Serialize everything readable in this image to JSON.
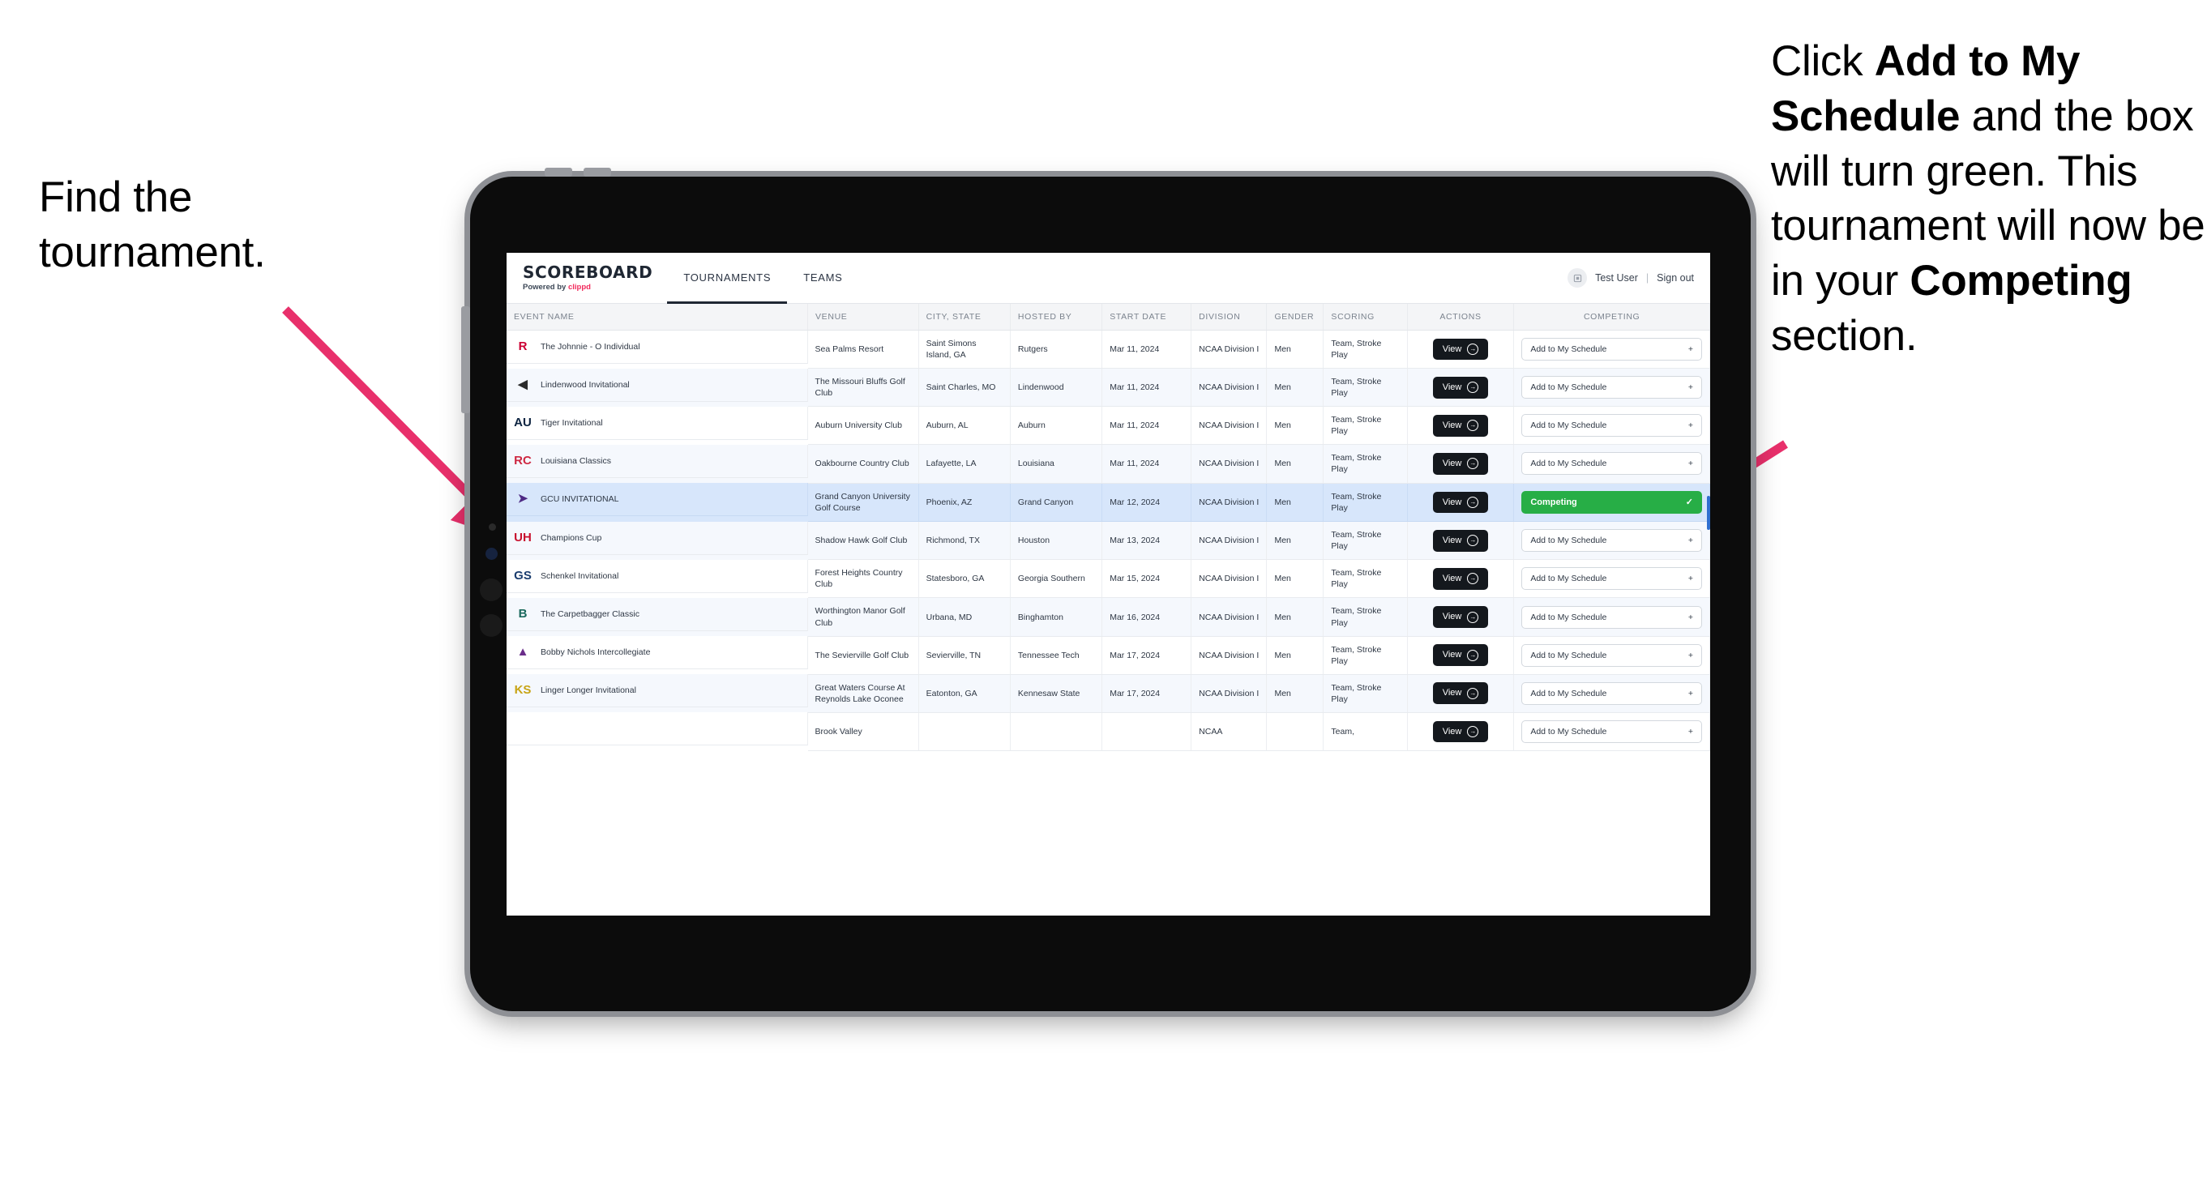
{
  "annotations": {
    "left": "Find the tournament.",
    "right_parts": [
      {
        "t": "Click ",
        "b": false
      },
      {
        "t": "Add to My Schedule",
        "b": true
      },
      {
        "t": " and the box will turn green. This tournament will now be in your ",
        "b": false
      },
      {
        "t": "Competing",
        "b": true
      },
      {
        "t": " section.",
        "b": false
      }
    ],
    "arrow_color": "#e8306b"
  },
  "app": {
    "brand_title": "SCOREBOARD",
    "brand_powered_prefix": "Powered by ",
    "brand_powered_name": "clippd",
    "tabs": [
      {
        "label": "TOURNAMENTS",
        "active": true
      },
      {
        "label": "TEAMS",
        "active": false
      }
    ],
    "user_name": "Test User",
    "separator": "|",
    "sign_out": "Sign out",
    "avatar_icon": "user-avatar-icon"
  },
  "table": {
    "columns": [
      "EVENT NAME",
      "VENUE",
      "CITY, STATE",
      "HOSTED BY",
      "START DATE",
      "DIVISION",
      "GENDER",
      "SCORING",
      "ACTIONS",
      "COMPETING"
    ],
    "view_label": "View",
    "add_label": "Add to My Schedule",
    "add_plus": "+",
    "competing_label": "Competing",
    "competing_check": "✓",
    "competing_color": "#27ae46",
    "selected_row_color": "#d7e6fb",
    "rows": [
      {
        "event": "The Johnnie - O Individual",
        "venue": "Sea Palms Resort",
        "city": "Saint Simons Island, GA",
        "host": "Rutgers",
        "date": "Mar 11, 2024",
        "division": "NCAA Division I",
        "gender": "Men",
        "scoring": "Team, Stroke Play",
        "competing": false,
        "logo": "rutgers-logo",
        "logo_text": "R",
        "logo_color": "#cc0033"
      },
      {
        "event": "Lindenwood Invitational",
        "venue": "The Missouri Bluffs Golf Club",
        "city": "Saint Charles, MO",
        "host": "Lindenwood",
        "date": "Mar 11, 2024",
        "division": "NCAA Division I",
        "gender": "Men",
        "scoring": "Team, Stroke Play",
        "competing": false,
        "logo": "lindenwood-lion-logo",
        "logo_text": "◀",
        "logo_color": "#2b2b2b"
      },
      {
        "event": "Tiger Invitational",
        "venue": "Auburn University Club",
        "city": "Auburn, AL",
        "host": "Auburn",
        "date": "Mar 11, 2024",
        "division": "NCAA Division I",
        "gender": "Men",
        "scoring": "Team, Stroke Play",
        "competing": false,
        "logo": "auburn-au-logo",
        "logo_text": "AU",
        "logo_color": "#0c2340"
      },
      {
        "event": "Louisiana Classics",
        "venue": "Oakbourne Country Club",
        "city": "Lafayette, LA",
        "host": "Louisiana",
        "date": "Mar 11, 2024",
        "division": "NCAA Division I",
        "gender": "Men",
        "scoring": "Team, Stroke Play",
        "competing": false,
        "logo": "ragin-cajuns-logo",
        "logo_text": "RC",
        "logo_color": "#ce2842"
      },
      {
        "event": "GCU INVITATIONAL",
        "venue": "Grand Canyon University Golf Course",
        "city": "Phoenix, AZ",
        "host": "Grand Canyon",
        "date": "Mar 12, 2024",
        "division": "NCAA Division I",
        "gender": "Men",
        "scoring": "Team, Stroke Play",
        "competing": true,
        "logo": "grand-canyon-lopes-logo",
        "logo_text": "➤",
        "logo_color": "#4e2a84"
      },
      {
        "event": "Champions Cup",
        "venue": "Shadow Hawk Golf Club",
        "city": "Richmond, TX",
        "host": "Houston",
        "date": "Mar 13, 2024",
        "division": "NCAA Division I",
        "gender": "Men",
        "scoring": "Team, Stroke Play",
        "competing": false,
        "logo": "houston-uh-logo",
        "logo_text": "UH",
        "logo_color": "#c8102e"
      },
      {
        "event": "Schenkel Invitational",
        "venue": "Forest Heights Country Club",
        "city": "Statesboro, GA",
        "host": "Georgia Southern",
        "date": "Mar 15, 2024",
        "division": "NCAA Division I",
        "gender": "Men",
        "scoring": "Team, Stroke Play",
        "competing": false,
        "logo": "georgia-southern-eagles-logo",
        "logo_text": "GS",
        "logo_color": "#1a3c6e"
      },
      {
        "event": "The Carpetbagger Classic",
        "venue": "Worthington Manor Golf Club",
        "city": "Urbana, MD",
        "host": "Binghamton",
        "date": "Mar 16, 2024",
        "division": "NCAA Division I",
        "gender": "Men",
        "scoring": "Team, Stroke Play",
        "competing": false,
        "logo": "binghamton-bearcats-logo",
        "logo_text": "B",
        "logo_color": "#19685c"
      },
      {
        "event": "Bobby Nichols Intercollegiate",
        "venue": "The Sevierville Golf Club",
        "city": "Sevierville, TN",
        "host": "Tennessee Tech",
        "date": "Mar 17, 2024",
        "division": "NCAA Division I",
        "gender": "Men",
        "scoring": "Team, Stroke Play",
        "competing": false,
        "logo": "tennessee-tech-eagle-logo",
        "logo_text": "▲",
        "logo_color": "#6a2d8a"
      },
      {
        "event": "Linger Longer Invitational",
        "venue": "Great Waters Course At Reynolds Lake Oconee",
        "city": "Eatonton, GA",
        "host": "Kennesaw State",
        "date": "Mar 17, 2024",
        "division": "NCAA Division I",
        "gender": "Men",
        "scoring": "Team, Stroke Play",
        "competing": false,
        "logo": "kennesaw-state-owls-logo",
        "logo_text": "KS",
        "logo_color": "#c8a415"
      },
      {
        "event": "",
        "venue": "Brook Valley",
        "city": "",
        "host": "",
        "date": "",
        "division": "NCAA",
        "gender": "",
        "scoring": "Team,",
        "competing": false,
        "logo": "partial-row-logo",
        "logo_text": "",
        "logo_color": "#6a2d8a",
        "partial": true
      }
    ]
  }
}
